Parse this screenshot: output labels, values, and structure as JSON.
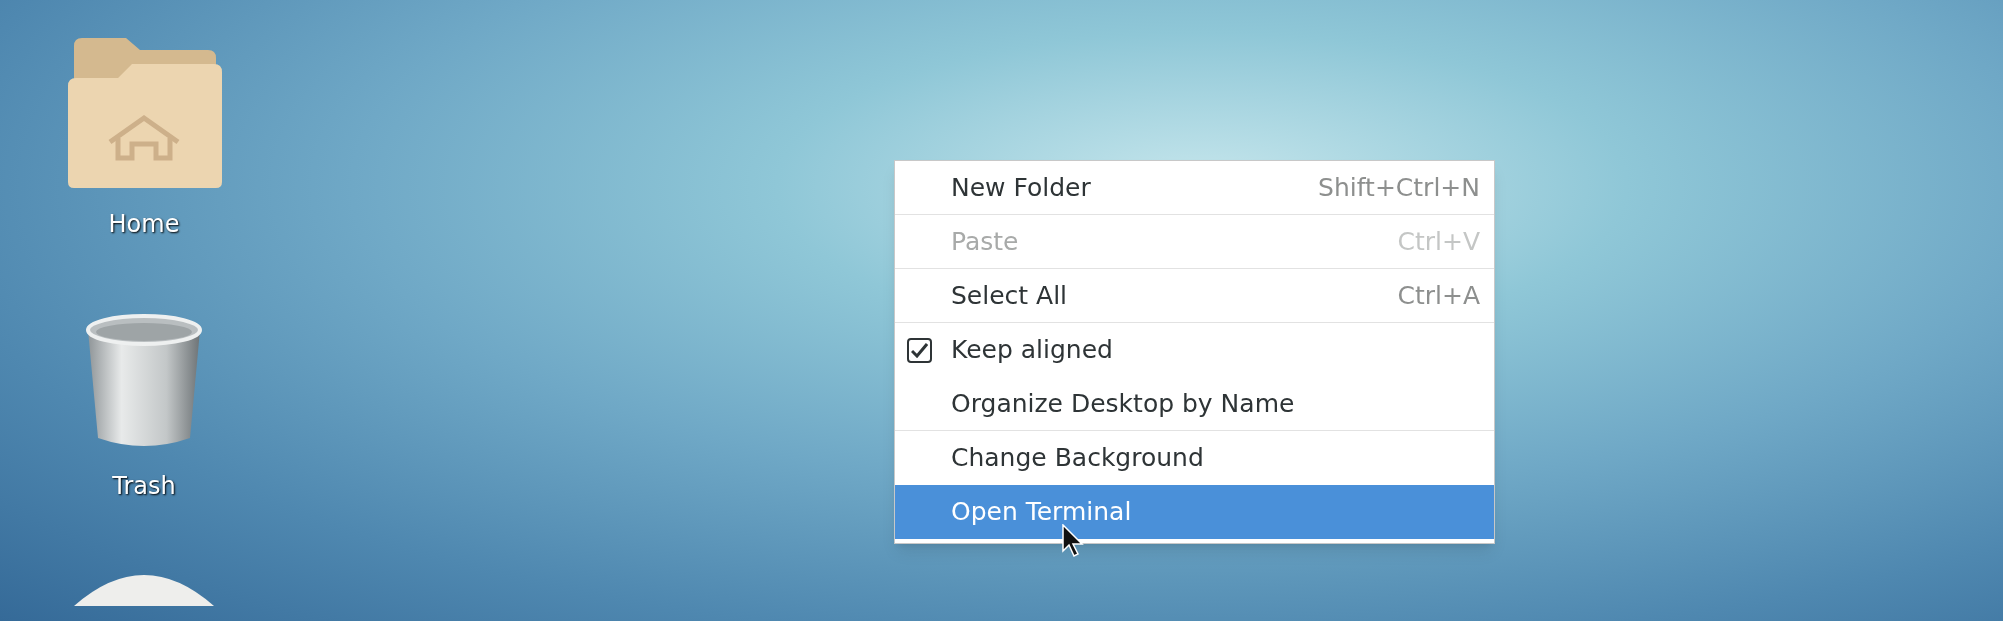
{
  "desktop_icons": [
    {
      "kind": "folder",
      "label": "Home"
    },
    {
      "kind": "trash",
      "label": "Trash"
    },
    {
      "kind": "disk"
    }
  ],
  "context_menu": {
    "items": [
      {
        "kind": "plain",
        "label": "New Folder",
        "shortcut": "Shift+Ctrl+N",
        "disabled": false,
        "selected": false,
        "separator_after": true
      },
      {
        "kind": "plain",
        "label": "Paste",
        "shortcut": "Ctrl+V",
        "disabled": true,
        "selected": false,
        "separator_after": true
      },
      {
        "kind": "plain",
        "label": "Select All",
        "shortcut": "Ctrl+A",
        "disabled": false,
        "selected": false,
        "separator_after": true
      },
      {
        "kind": "check",
        "label": "Keep aligned",
        "checked": true,
        "disabled": false,
        "selected": false,
        "separator_after": false
      },
      {
        "kind": "plain",
        "label": "Organize Desktop by Name",
        "disabled": false,
        "selected": false,
        "separator_after": true
      },
      {
        "kind": "plain",
        "label": "Change Background",
        "disabled": false,
        "selected": false,
        "separator_after": false
      },
      {
        "kind": "plain",
        "label": "Open Terminal",
        "disabled": false,
        "selected": true,
        "separator_after": false
      }
    ]
  }
}
